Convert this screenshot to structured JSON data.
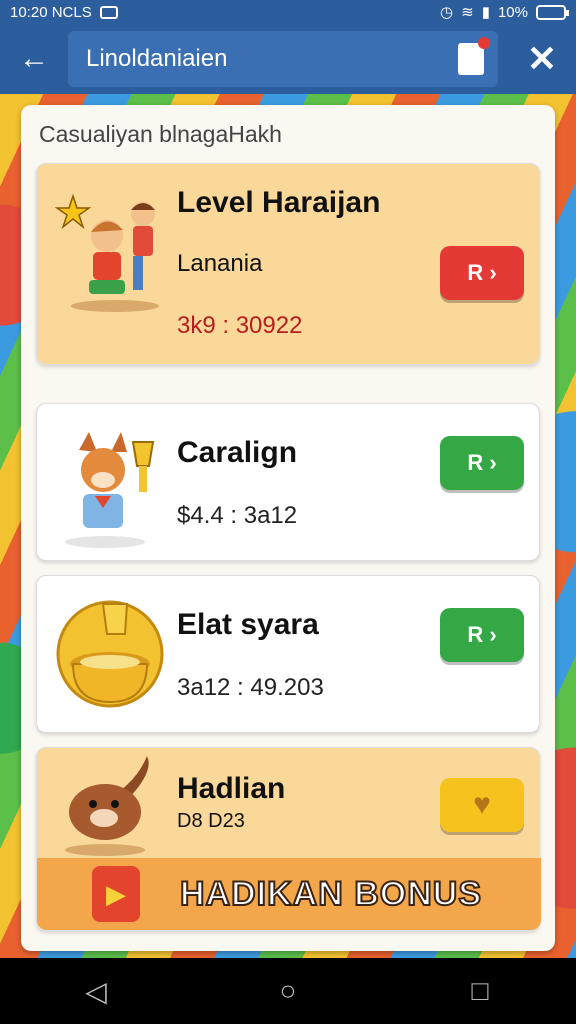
{
  "status": {
    "time": "10:20 NCLS",
    "battery": "10%"
  },
  "appbar": {
    "search_value": "Linoldaniaien",
    "back_icon": "back-arrow-icon",
    "close_icon": "close-icon"
  },
  "panel": {
    "title": "Casualiyan blnagaHakh"
  },
  "cards": [
    {
      "title": "Level Haraijan",
      "subtitle": "Lanania",
      "value": "3k9 : 30922",
      "action": "R ›",
      "action_color": "#e53935",
      "value_color": "#b51f1f"
    },
    {
      "title": "Caralign",
      "subtitle": "",
      "value": "$4.4 : 3a12",
      "action": "R ›",
      "action_color": "#34a844",
      "value_color": "#222"
    },
    {
      "title": "Elat syara",
      "subtitle": "",
      "value": "3a12 : 49.203",
      "action": "R ›",
      "action_color": "#34a844",
      "value_color": "#222"
    },
    {
      "title": "Hadlian",
      "subtitle": "D8 D23",
      "value": "",
      "action": "♥",
      "action_color": "#f6c21d",
      "value_color": "#222"
    }
  ],
  "bonus": {
    "label": "HADIKAN BONUS"
  },
  "navbar": {
    "back": "◁",
    "home": "○",
    "recents": "□"
  }
}
